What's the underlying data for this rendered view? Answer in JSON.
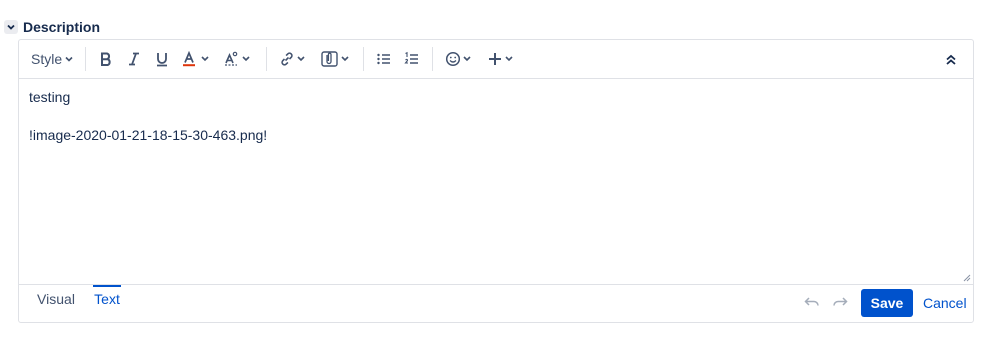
{
  "section": {
    "title": "Description"
  },
  "toolbar": {
    "style_label": "Style"
  },
  "content": {
    "lines": [
      "testing",
      "",
      "!image-2020-01-21-18-15-30-463.png!"
    ]
  },
  "footer": {
    "tabs": [
      "Visual",
      "Text"
    ],
    "active_tab": "Text",
    "save_label": "Save",
    "cancel_label": "Cancel"
  },
  "colors": {
    "primary": "#0052cc",
    "text": "#172b4d",
    "icon": "#42526e",
    "border": "#dfe1e6",
    "text_color_underline": "#de350b"
  }
}
